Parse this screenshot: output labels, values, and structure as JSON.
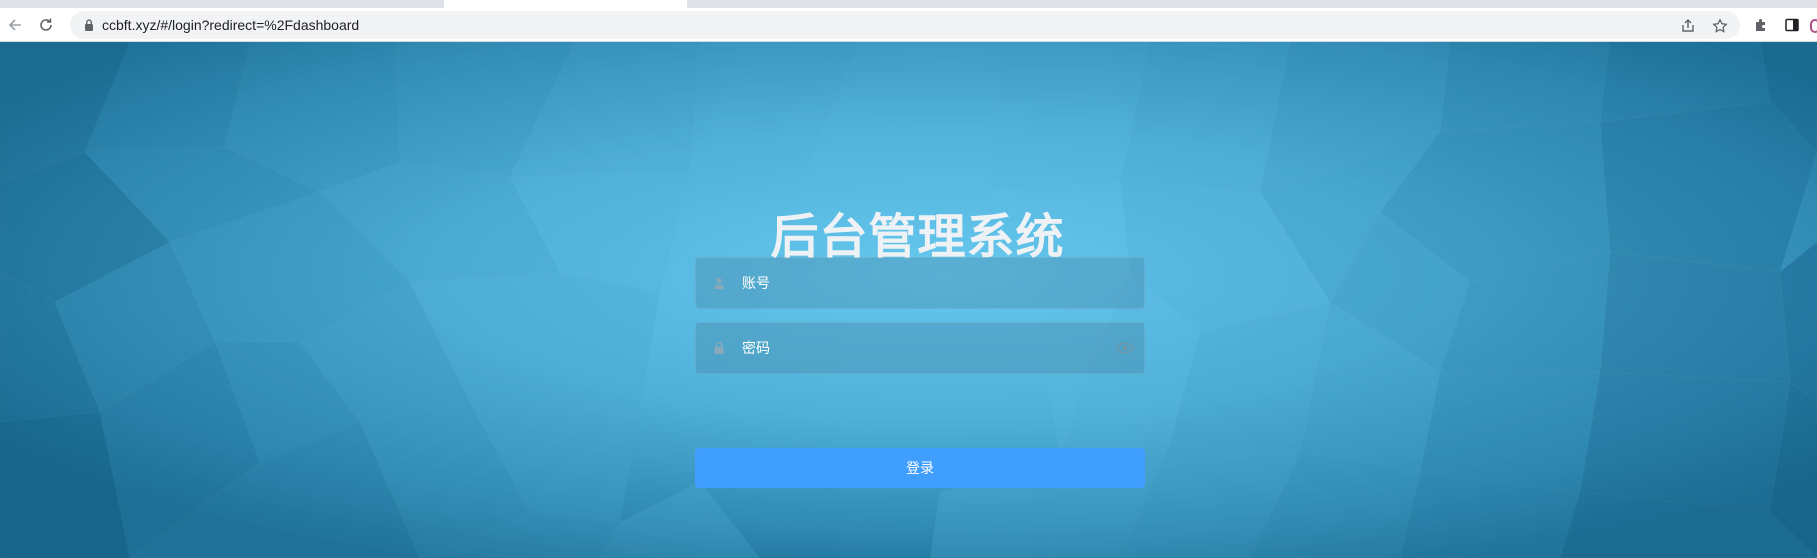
{
  "browser": {
    "url": "ccbft.xyz/#/login?redirect=%2Fdashboard",
    "icons": [
      "back-arrow-icon",
      "reload-icon",
      "lock-icon",
      "share-icon",
      "star-icon",
      "extensions-icon",
      "side-panel-icon"
    ]
  },
  "login": {
    "title": "后台管理系统",
    "username_placeholder": "账号",
    "password_placeholder": "密码",
    "submit_label": "登录"
  },
  "colors": {
    "primary_button": "#409eff",
    "background_base": "#3f9dc4"
  }
}
